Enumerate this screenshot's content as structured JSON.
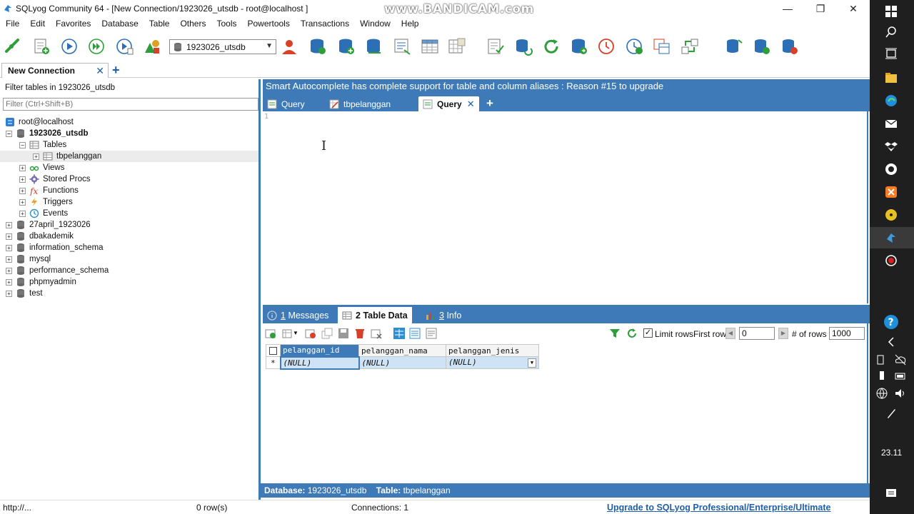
{
  "window": {
    "title": "SQLyog Community 64 - [New Connection/1923026_utsdb - root@localhost ]",
    "watermark": "www.BANDICAM.com",
    "minimize": "—",
    "maximize": "❐",
    "close": "✕"
  },
  "menu": [
    "File",
    "Edit",
    "Favorites",
    "Database",
    "Table",
    "Others",
    "Tools",
    "Powertools",
    "Transactions",
    "Window",
    "Help"
  ],
  "toolbar": {
    "database_select": "1923026_utsdb"
  },
  "connection_tab": {
    "label": "New Connection",
    "close": "✕",
    "add": "+"
  },
  "object_browser": {
    "filter_label": "Filter tables in 1923026_utsdb",
    "filter_placeholder": "Filter (Ctrl+Shift+B)",
    "root": "root@localhost",
    "current_db": "1923026_utsdb",
    "groups": {
      "tables": "Tables",
      "table_item": "tbpelanggan",
      "views": "Views",
      "procs": "Stored Procs",
      "functions": "Functions",
      "triggers": "Triggers",
      "events": "Events"
    },
    "databases": [
      "27april_1923026",
      "dbakademik",
      "information_schema",
      "mysql",
      "performance_schema",
      "phpmyadmin",
      "test"
    ],
    "expand_sign": "+",
    "collapse_sign": "−"
  },
  "banner": "Smart Autocomplete has complete support for table and column aliases : Reason #15 to upgrade",
  "query_tabs": [
    {
      "label": "Query"
    },
    {
      "label": "tbpelanggan"
    },
    {
      "label": "Query"
    }
  ],
  "query_tab_close": "✕",
  "query_tab_add": "+",
  "editor": {
    "line_number": "1",
    "cursor": "I"
  },
  "result_tabs": [
    {
      "num": "1",
      "label": "Messages"
    },
    {
      "num": "2",
      "label": "Table Data"
    },
    {
      "num": "3",
      "label": "Info"
    }
  ],
  "result_toolbar": {
    "limit_rows_label": "Limit rows",
    "limit_checked": "✓",
    "first_row_label": "First row",
    "first_row_value": "0",
    "num_rows_label": "# of rows",
    "num_rows_value": "1000",
    "prev": "◀",
    "next": "▶"
  },
  "grid": {
    "columns": [
      "pelanggan_id",
      "pelanggan_nama",
      "pelanggan_jenis"
    ],
    "row_marker": "*",
    "values": [
      "(NULL)",
      "(NULL)",
      "(NULL)"
    ],
    "dropdown": "▼"
  },
  "db_status": {
    "database_label": "Database:",
    "database_value": "1923026_utsdb",
    "table_label": "Table:",
    "table_value": "tbpelanggan"
  },
  "status": {
    "url": "http://...",
    "rows": "0 row(s)",
    "connections": "Connections: 1",
    "upgrade": "Upgrade to SQLyog Professional/Enterprise/Ultimate"
  },
  "taskbar": {
    "time": "23.11"
  },
  "colors": {
    "accent": "#3e7ab8",
    "link": "#1f5fa8",
    "taskbar": "#1f1f1f"
  }
}
